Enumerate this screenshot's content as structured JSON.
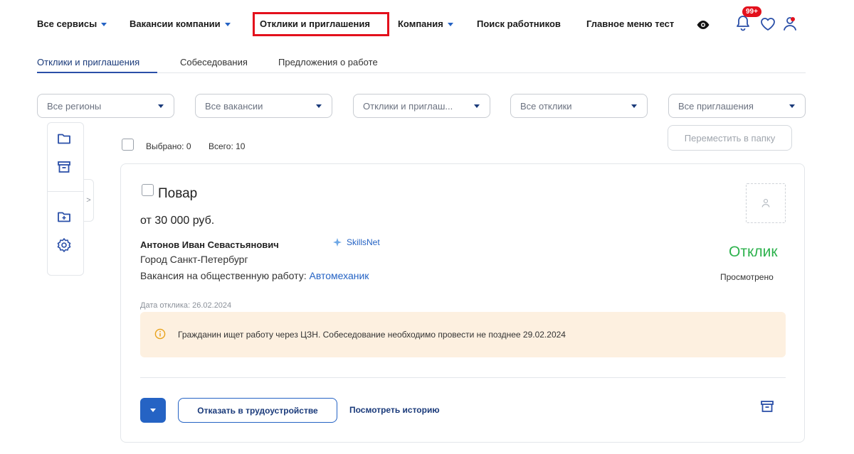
{
  "colors": {
    "accent": "#2563c4",
    "highlight_border": "#e3101c",
    "status_green": "#2db24d",
    "alert_bg": "#fdf0e0"
  },
  "topnav": {
    "items": [
      {
        "label": "Все сервисы",
        "dropdown": true
      },
      {
        "label": "Вакансии компании",
        "dropdown": true
      },
      {
        "label": "Отклики и приглашения",
        "dropdown": false,
        "highlighted": true
      },
      {
        "label": "Компания",
        "dropdown": true
      },
      {
        "label": "Поиск работников",
        "dropdown": false
      },
      {
        "label": "Главное меню тест",
        "dropdown": false
      }
    ],
    "icons": [
      "eye-icon",
      "bell-icon",
      "heart-icon",
      "user-icon"
    ],
    "notification_badge": "99+"
  },
  "tabs": [
    {
      "label": "Отклики и приглашения",
      "active": true
    },
    {
      "label": "Собеседования",
      "active": false
    },
    {
      "label": "Предложения о работе",
      "active": false
    }
  ],
  "filters": [
    {
      "value": "Все регионы"
    },
    {
      "value": "Все вакансии"
    },
    {
      "value": "Отклики и приглаш..."
    },
    {
      "value": "Все отклики"
    },
    {
      "value": "Все приглашения"
    }
  ],
  "toolbar": {
    "move_to_folder": "Переместить в папку",
    "selected": "Выбрано: 0",
    "total": "Всего: 10"
  },
  "sidebar": {
    "icons": [
      "folder-icon",
      "archive-icon",
      "folder-plus-icon",
      "settings-icon"
    ]
  },
  "card": {
    "title": "Повар",
    "salary": "от 30 000 руб.",
    "person": "Антонов Иван Севастьянович",
    "source": "SkillsNet",
    "city": "Город Санкт-Петербург",
    "vacancy_prefix": "Вакансия на общественную работу: ",
    "vacancy_link": "Автомеханик",
    "date": "Дата отклика: 26.02.2024",
    "status": "Отклик",
    "status_sub": "Просмотрено",
    "alert": "Гражданин ищет работу через ЦЗН. Собеседование необходимо провести не позднее 29.02.2024",
    "reject_button": "Отказать в трудоустройстве",
    "history_link": "Посмотреть историю"
  }
}
